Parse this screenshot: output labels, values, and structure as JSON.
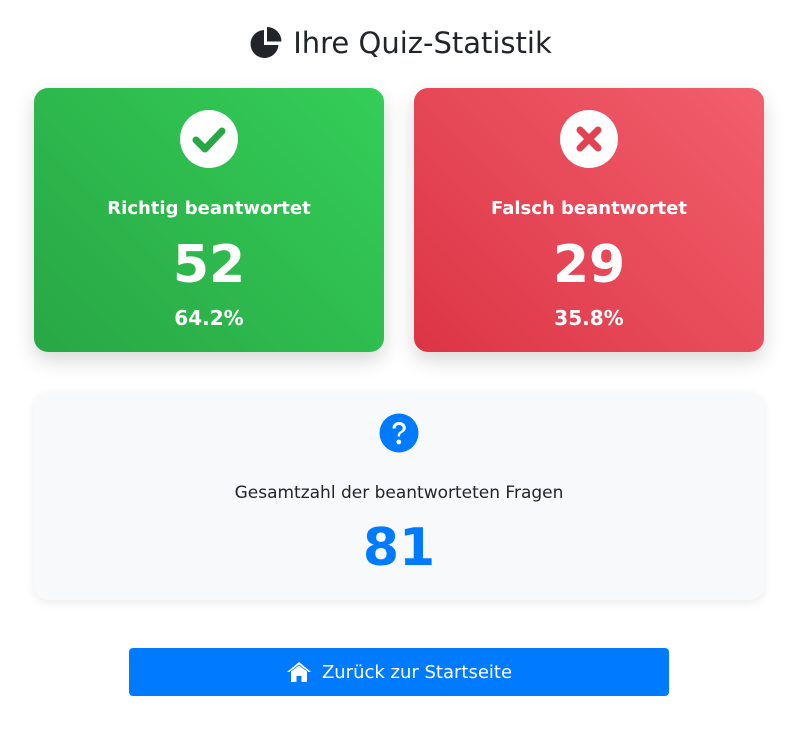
{
  "title": "Ihre Quiz-Statistik",
  "title_icon": "chart-pie-icon",
  "correct": {
    "label": "Richtig beantwortet",
    "count": "52",
    "percent": "64.2%",
    "icon": "check-circle-icon",
    "color": "#28a745"
  },
  "wrong": {
    "label": "Falsch beantwortet",
    "count": "29",
    "percent": "35.8%",
    "icon": "times-circle-icon",
    "color": "#dc3545"
  },
  "total": {
    "label": "Gesamtzahl der beantworteten Fragen",
    "count": "81",
    "icon": "question-circle-icon",
    "color": "#007bff"
  },
  "home_button": {
    "label": "Zurück zur Startseite",
    "icon": "home-icon"
  }
}
